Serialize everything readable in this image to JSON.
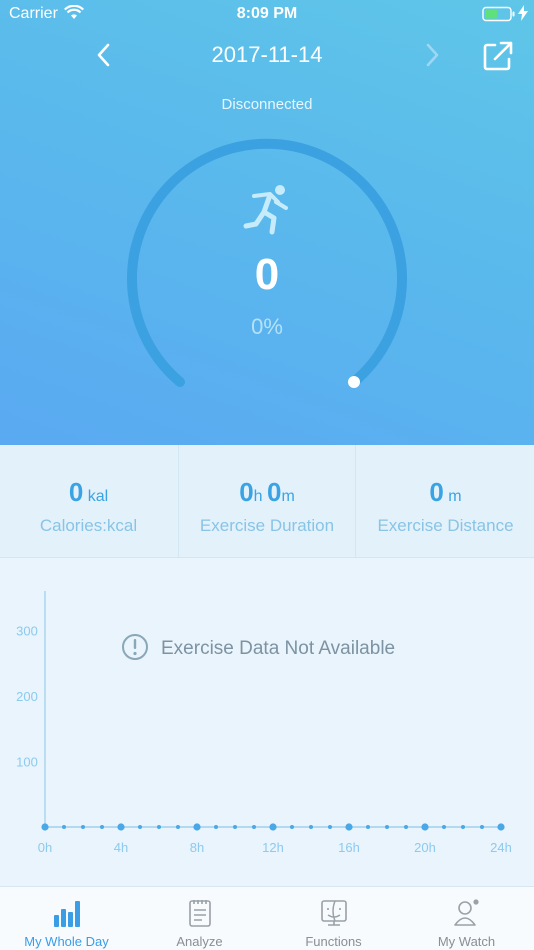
{
  "status_bar": {
    "carrier": "Carrier",
    "time": "8:09 PM"
  },
  "header": {
    "date": "2017-11-14",
    "connection_status": "Disconnected"
  },
  "gauge": {
    "steps": "0",
    "percent": "0%",
    "progress": 0
  },
  "stats": [
    {
      "value": "0",
      "unit": "kal",
      "label": "Calories:kcal"
    },
    {
      "hours": "0",
      "hours_unit": "h",
      "minutes": "0",
      "minutes_unit": "m",
      "label": "Exercise Duration"
    },
    {
      "value": "0",
      "unit": "m",
      "label": "Exercise Distance"
    }
  ],
  "chart": {
    "empty_message": "Exercise Data Not Available",
    "y_ticks": [
      "300",
      "200",
      "100"
    ],
    "x_ticks": [
      "0h",
      "4h",
      "8h",
      "12h",
      "16h",
      "20h",
      "24h"
    ]
  },
  "chart_data": {
    "type": "line",
    "xlabel": "",
    "ylabel": "",
    "x": [
      "0h",
      "1h",
      "2h",
      "3h",
      "4h",
      "5h",
      "6h",
      "7h",
      "8h",
      "9h",
      "10h",
      "11h",
      "12h",
      "13h",
      "14h",
      "15h",
      "16h",
      "17h",
      "18h",
      "19h",
      "20h",
      "21h",
      "22h",
      "23h",
      "24h"
    ],
    "values": [
      0,
      0,
      0,
      0,
      0,
      0,
      0,
      0,
      0,
      0,
      0,
      0,
      0,
      0,
      0,
      0,
      0,
      0,
      0,
      0,
      0,
      0,
      0,
      0,
      0
    ],
    "ylim": [
      0,
      360
    ],
    "y_ticks": [
      100,
      200,
      300
    ],
    "grid": false
  },
  "tabs": [
    {
      "label": "My Whole Day",
      "active": true
    },
    {
      "label": "Analyze",
      "active": false
    },
    {
      "label": "Functions",
      "active": false
    },
    {
      "label": "My Watch",
      "active": false
    }
  ],
  "colors": {
    "accent": "#3a9de6",
    "gauge_track": "#3ba1e0",
    "hero_bg": "#5ab9ec",
    "axis": "#a9d5f0"
  }
}
